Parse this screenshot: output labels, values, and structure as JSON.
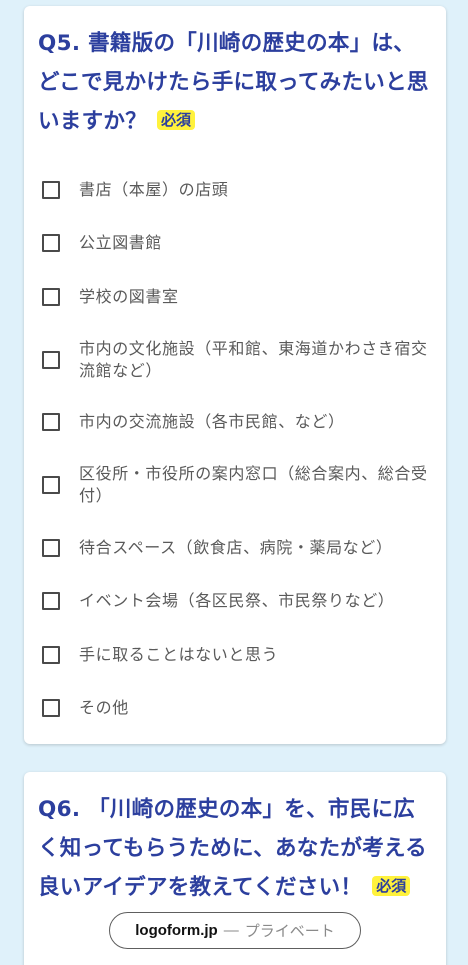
{
  "q5": {
    "title": "Q5. 書籍版の「川崎の歴史の本」は、どこで見かけたら手に取ってみたいと思いますか？",
    "required_label": "必須",
    "options": [
      {
        "label": "書店（本屋）の店頭"
      },
      {
        "label": "公立図書館"
      },
      {
        "label": "学校の図書室"
      },
      {
        "label": "市内の文化施設（平和館、東海道かわさき宿交流館など）"
      },
      {
        "label": "市内の交流施設（各市民館、など）"
      },
      {
        "label": "区役所・市役所の案内窓口（総合案内、総合受付）"
      },
      {
        "label": "待合スペース（飲食店、病院・薬局など）"
      },
      {
        "label": "イベント会場（各区民祭、市民祭りなど）"
      },
      {
        "label": "手に取ることはないと思う"
      },
      {
        "label": "その他"
      }
    ]
  },
  "q6": {
    "title": "Q6. 「川崎の歴史の本」を、市民に広く知ってもらうために、あなたが考える良いアイデアを教えてください！",
    "required_label": "必須"
  },
  "toast": {
    "brand": "logoform.jp",
    "separator": "—",
    "privacy": "プライベート"
  },
  "colors": {
    "background": "#dff1fa",
    "title": "#2c3f9e",
    "badge": "#fff23c"
  }
}
